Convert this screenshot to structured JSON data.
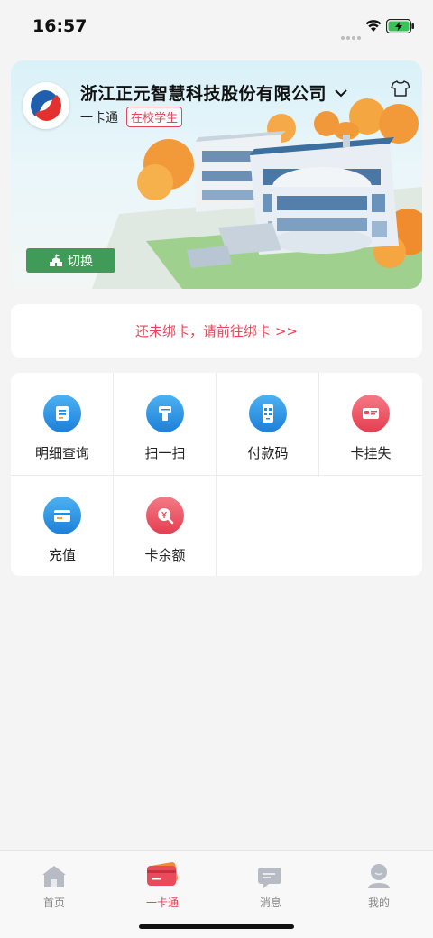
{
  "status_bar": {
    "time": "16:57"
  },
  "header": {
    "company_name": "浙江正元智慧科技股份有限公司",
    "card_label": "一卡通",
    "status_badge": "在校学生",
    "switch_label": "切换"
  },
  "bind_card_notice": "还未绑卡，请前往绑卡 >>",
  "services": [
    {
      "label": "明细查询",
      "icon": "detail-query-icon"
    },
    {
      "label": "扫一扫",
      "icon": "scan-icon"
    },
    {
      "label": "付款码",
      "icon": "payment-code-icon"
    },
    {
      "label": "卡挂失",
      "icon": "card-loss-icon"
    },
    {
      "label": "充值",
      "icon": "recharge-icon"
    },
    {
      "label": "卡余额",
      "icon": "card-balance-icon"
    }
  ],
  "tabbar": [
    {
      "label": "首页",
      "icon": "home-icon"
    },
    {
      "label": "一卡通",
      "icon": "card-icon",
      "active": true
    },
    {
      "label": "消息",
      "icon": "message-icon"
    },
    {
      "label": "我的",
      "icon": "profile-icon"
    }
  ],
  "colors": {
    "accent": "#e2485a",
    "switch_green": "#3f9b57",
    "icon_blue": "#1e8fe0",
    "icon_red": "#ea4b5b"
  }
}
